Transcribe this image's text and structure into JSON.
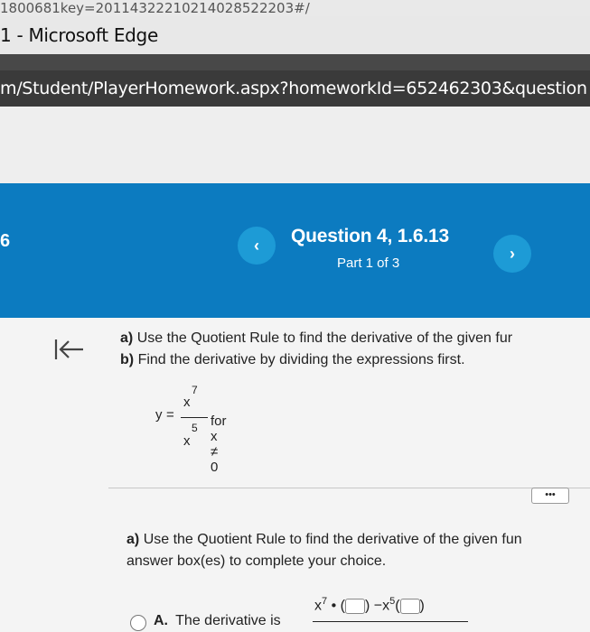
{
  "browser": {
    "url_fragment": "1800681key=20114322210214028522203#/",
    "window_title": "1 - Microsoft Edge",
    "address": "m/Student/PlayerHomework.aspx?homeworkId=652462303&question"
  },
  "header": {
    "question_number": "6",
    "title": "Question 4, 1.6.13",
    "part": "Part 1 of 3",
    "prev_icon": "‹",
    "next_icon": "›",
    "color": "#0c7bc0"
  },
  "question": {
    "line_a_label": "a)",
    "line_a_text": "Use the Quotient Rule to find the derivative of the given fur",
    "line_b_label": "b)",
    "line_b_text": "Find the derivative by dividing the expressions first.",
    "equation": {
      "lhs": "y",
      "equals": "=",
      "numerator": "x",
      "numerator_exp": "7",
      "denominator": "x",
      "denominator_exp": "5",
      "condition": "for x ≠ 0"
    }
  },
  "more_button": "•••",
  "answer": {
    "part_label": "a)",
    "prompt_line1": "Use the Quotient Rule to find the derivative of the given fun",
    "prompt_line2": "answer box(es) to complete your choice.",
    "option_label": "A.",
    "option_text": "The derivative is",
    "frac_x": "x",
    "frac_exp1": "7",
    "frac_dot": "•",
    "frac_minus": "−x",
    "frac_exp2": "5"
  }
}
